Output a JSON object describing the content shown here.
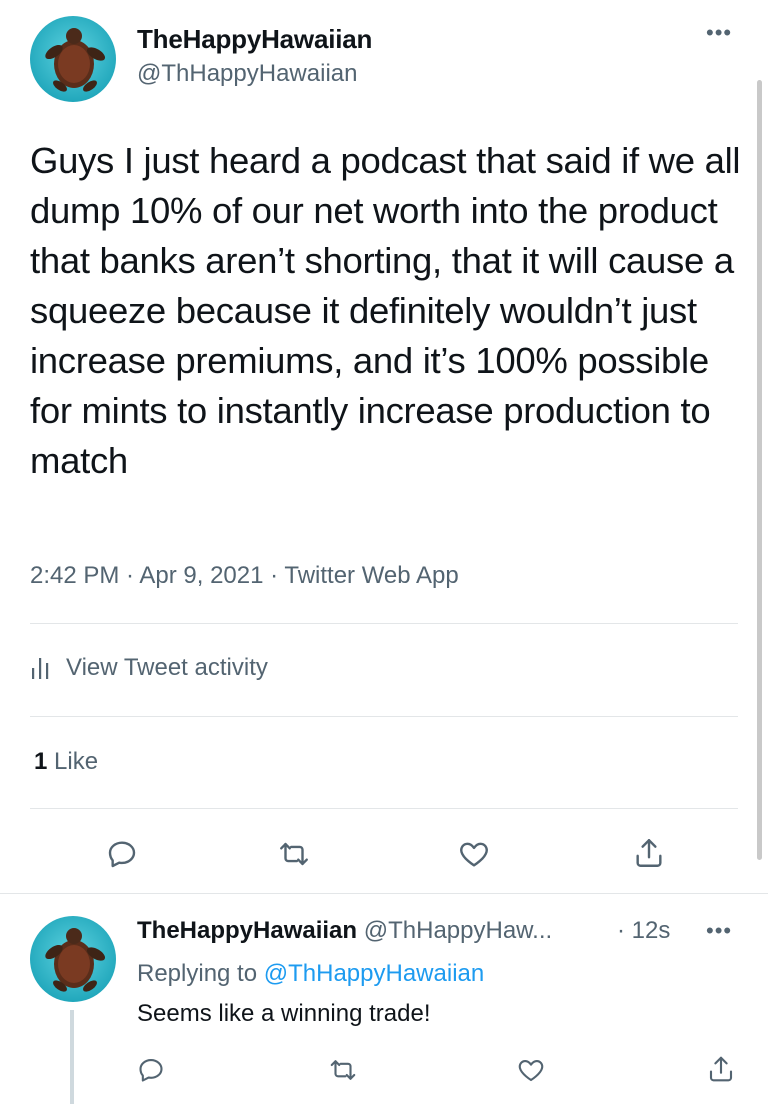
{
  "tweet": {
    "author_name": "TheHappyHawaiian",
    "author_handle": "@ThHappyHawaiian",
    "more_label": "•••",
    "text": "Guys I just heard a podcast that said if we all dump 10% of our net worth into the product that banks aren’t shorting, that it will cause a squeeze because it definitely wouldn’t just increase premiums, and it’s 100% possible for mints to instantly increase production to match",
    "meta": "2:42 PM · Apr 9, 2021 · Twitter Web App",
    "activity_label": "View Tweet activity",
    "likes_count": "1",
    "likes_label": "Like"
  },
  "reply": {
    "author_name": "TheHappyHawaiian",
    "author_handle": "@ThHappyHaw...",
    "time": "· 12s",
    "more_label": "•••",
    "replying_prefix": "Replying to",
    "replying_to": "@ThHappyHawaiian",
    "text": "Seems like a winning trade!"
  },
  "icons": [
    "reply-icon",
    "retweet-icon",
    "like-icon",
    "share-icon",
    "activity-icon",
    "more-icon"
  ],
  "colors": {
    "text": "#0f1419",
    "secondary": "#536471",
    "link": "#1d9bf0",
    "divider": "#e3e6e8"
  }
}
